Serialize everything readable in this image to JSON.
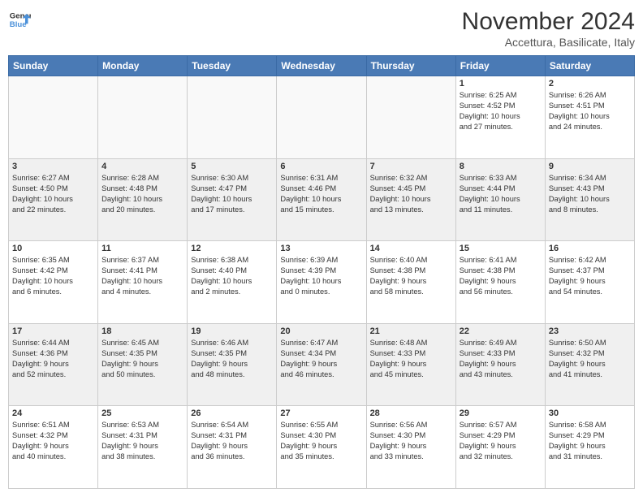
{
  "logo": {
    "line1": "General",
    "line2": "Blue",
    "icon_color": "#4a90d9"
  },
  "header": {
    "month": "November 2024",
    "location": "Accettura, Basilicate, Italy"
  },
  "weekdays": [
    "Sunday",
    "Monday",
    "Tuesday",
    "Wednesday",
    "Thursday",
    "Friday",
    "Saturday"
  ],
  "weeks": [
    [
      {
        "day": "",
        "info": ""
      },
      {
        "day": "",
        "info": ""
      },
      {
        "day": "",
        "info": ""
      },
      {
        "day": "",
        "info": ""
      },
      {
        "day": "",
        "info": ""
      },
      {
        "day": "1",
        "info": "Sunrise: 6:25 AM\nSunset: 4:52 PM\nDaylight: 10 hours\nand 27 minutes."
      },
      {
        "day": "2",
        "info": "Sunrise: 6:26 AM\nSunset: 4:51 PM\nDaylight: 10 hours\nand 24 minutes."
      }
    ],
    [
      {
        "day": "3",
        "info": "Sunrise: 6:27 AM\nSunset: 4:50 PM\nDaylight: 10 hours\nand 22 minutes."
      },
      {
        "day": "4",
        "info": "Sunrise: 6:28 AM\nSunset: 4:48 PM\nDaylight: 10 hours\nand 20 minutes."
      },
      {
        "day": "5",
        "info": "Sunrise: 6:30 AM\nSunset: 4:47 PM\nDaylight: 10 hours\nand 17 minutes."
      },
      {
        "day": "6",
        "info": "Sunrise: 6:31 AM\nSunset: 4:46 PM\nDaylight: 10 hours\nand 15 minutes."
      },
      {
        "day": "7",
        "info": "Sunrise: 6:32 AM\nSunset: 4:45 PM\nDaylight: 10 hours\nand 13 minutes."
      },
      {
        "day": "8",
        "info": "Sunrise: 6:33 AM\nSunset: 4:44 PM\nDaylight: 10 hours\nand 11 minutes."
      },
      {
        "day": "9",
        "info": "Sunrise: 6:34 AM\nSunset: 4:43 PM\nDaylight: 10 hours\nand 8 minutes."
      }
    ],
    [
      {
        "day": "10",
        "info": "Sunrise: 6:35 AM\nSunset: 4:42 PM\nDaylight: 10 hours\nand 6 minutes."
      },
      {
        "day": "11",
        "info": "Sunrise: 6:37 AM\nSunset: 4:41 PM\nDaylight: 10 hours\nand 4 minutes."
      },
      {
        "day": "12",
        "info": "Sunrise: 6:38 AM\nSunset: 4:40 PM\nDaylight: 10 hours\nand 2 minutes."
      },
      {
        "day": "13",
        "info": "Sunrise: 6:39 AM\nSunset: 4:39 PM\nDaylight: 10 hours\nand 0 minutes."
      },
      {
        "day": "14",
        "info": "Sunrise: 6:40 AM\nSunset: 4:38 PM\nDaylight: 9 hours\nand 58 minutes."
      },
      {
        "day": "15",
        "info": "Sunrise: 6:41 AM\nSunset: 4:38 PM\nDaylight: 9 hours\nand 56 minutes."
      },
      {
        "day": "16",
        "info": "Sunrise: 6:42 AM\nSunset: 4:37 PM\nDaylight: 9 hours\nand 54 minutes."
      }
    ],
    [
      {
        "day": "17",
        "info": "Sunrise: 6:44 AM\nSunset: 4:36 PM\nDaylight: 9 hours\nand 52 minutes."
      },
      {
        "day": "18",
        "info": "Sunrise: 6:45 AM\nSunset: 4:35 PM\nDaylight: 9 hours\nand 50 minutes."
      },
      {
        "day": "19",
        "info": "Sunrise: 6:46 AM\nSunset: 4:35 PM\nDaylight: 9 hours\nand 48 minutes."
      },
      {
        "day": "20",
        "info": "Sunrise: 6:47 AM\nSunset: 4:34 PM\nDaylight: 9 hours\nand 46 minutes."
      },
      {
        "day": "21",
        "info": "Sunrise: 6:48 AM\nSunset: 4:33 PM\nDaylight: 9 hours\nand 45 minutes."
      },
      {
        "day": "22",
        "info": "Sunrise: 6:49 AM\nSunset: 4:33 PM\nDaylight: 9 hours\nand 43 minutes."
      },
      {
        "day": "23",
        "info": "Sunrise: 6:50 AM\nSunset: 4:32 PM\nDaylight: 9 hours\nand 41 minutes."
      }
    ],
    [
      {
        "day": "24",
        "info": "Sunrise: 6:51 AM\nSunset: 4:32 PM\nDaylight: 9 hours\nand 40 minutes."
      },
      {
        "day": "25",
        "info": "Sunrise: 6:53 AM\nSunset: 4:31 PM\nDaylight: 9 hours\nand 38 minutes."
      },
      {
        "day": "26",
        "info": "Sunrise: 6:54 AM\nSunset: 4:31 PM\nDaylight: 9 hours\nand 36 minutes."
      },
      {
        "day": "27",
        "info": "Sunrise: 6:55 AM\nSunset: 4:30 PM\nDaylight: 9 hours\nand 35 minutes."
      },
      {
        "day": "28",
        "info": "Sunrise: 6:56 AM\nSunset: 4:30 PM\nDaylight: 9 hours\nand 33 minutes."
      },
      {
        "day": "29",
        "info": "Sunrise: 6:57 AM\nSunset: 4:29 PM\nDaylight: 9 hours\nand 32 minutes."
      },
      {
        "day": "30",
        "info": "Sunrise: 6:58 AM\nSunset: 4:29 PM\nDaylight: 9 hours\nand 31 minutes."
      }
    ]
  ]
}
